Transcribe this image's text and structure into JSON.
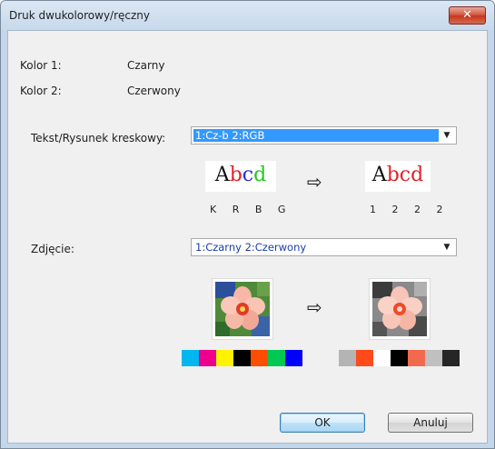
{
  "window": {
    "title": "Druk dwukolorowy/ręczny",
    "close_symbol": "✕"
  },
  "kolor1": {
    "label": "Kolor 1:",
    "value": "Czarny"
  },
  "kolor2": {
    "label": "Kolor 2:",
    "value": "Czerwony"
  },
  "text_mode": {
    "label": "Tekst/Rysunek kreskowy:",
    "selected": "1:Cz-b 2:RGB",
    "before_codes": "K R B G",
    "after_codes": "1 2 2 2"
  },
  "photo_mode": {
    "label": "Zdjęcie:",
    "selected": "1:Czarny 2:Czerwony"
  },
  "sample_text": {
    "a": "A",
    "b": "b",
    "c": "c",
    "d": "d"
  },
  "colors": {
    "before_swatches": [
      "#00b7ef",
      "#ec008c",
      "#fff200",
      "#000000",
      "#ff4e00",
      "#00c853",
      "#0000ff"
    ],
    "after_swatches": [
      "#b4b4b4",
      "#ff4a1a",
      "#ffffff",
      "#000000",
      "#f26a4e",
      "#c0c0c0",
      "#262626"
    ],
    "accent": "#3399ff"
  },
  "buttons": {
    "ok": "OK",
    "cancel": "Anuluj"
  },
  "icons": {
    "transform_arrow": "⇨",
    "dropdown": "▼"
  }
}
